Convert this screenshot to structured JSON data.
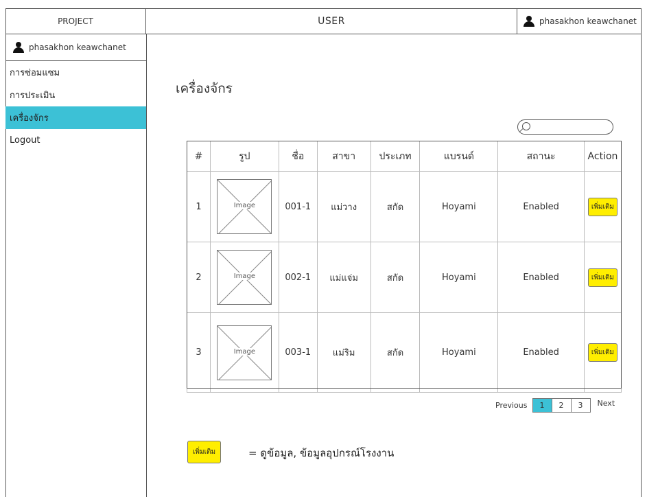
{
  "header": {
    "brand": "PROJECT",
    "title": "USER",
    "user_name": "phasakhon keawchanet"
  },
  "sidebar": {
    "user_name": "phasakhon keawchanet",
    "items": [
      {
        "label": "การซ่อมแซม"
      },
      {
        "label": "การประเมิน"
      },
      {
        "label": "เครื่องจักร"
      },
      {
        "label": "Logout"
      }
    ]
  },
  "main": {
    "title": "เครื่องจักร",
    "table": {
      "headers": [
        "#",
        "รูป",
        "ชื่อ",
        "สาขา",
        "ประเภท",
        "แบรนด์",
        "สถานะ",
        "Action"
      ],
      "rows": [
        {
          "num": "1",
          "image": "Image",
          "name": "001-1",
          "branch": "แม่วาง",
          "type": "สกัด",
          "brand": "Hoyami",
          "status": "Enabled",
          "action": "เพิ่มเติม"
        },
        {
          "num": "2",
          "image": "Image",
          "name": "002-1",
          "branch": "แม่แจ่ม",
          "type": "สกัด",
          "brand": "Hoyami",
          "status": "Enabled",
          "action": "เพิ่มเติม"
        },
        {
          "num": "3",
          "image": "Image",
          "name": "003-1",
          "branch": "แม่ริม",
          "type": "สกัด",
          "brand": "Hoyami",
          "status": "Enabled",
          "action": "เพิ่มเติม"
        }
      ]
    },
    "pagination": {
      "previous": "Previous",
      "pages": [
        "1",
        "2",
        "3"
      ],
      "current": "1",
      "next": "Next"
    },
    "legend": {
      "button": "เพิ่มเติม",
      "text": "= ดูข้อมูล, ข้อมูลอุปกรณ์โรงงาน"
    }
  },
  "colors": {
    "accent": "#3cc1d6",
    "action_button": "#ffee00"
  },
  "icons": {
    "user": "person-icon",
    "search": "search-icon"
  }
}
